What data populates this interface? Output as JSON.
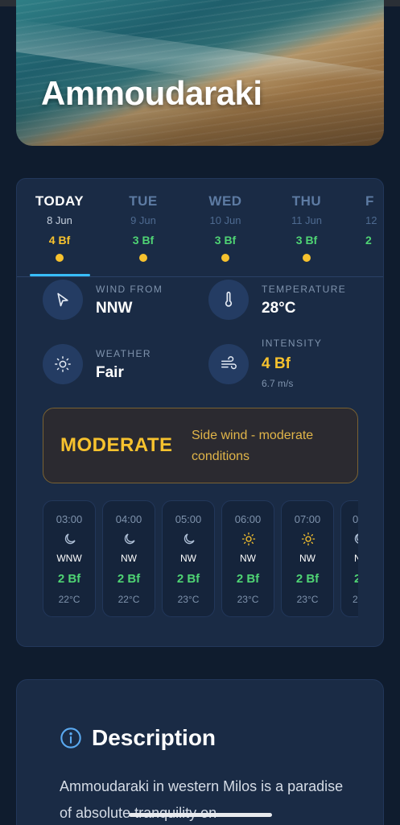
{
  "location": {
    "name": "Ammoudaraki"
  },
  "days": [
    {
      "name": "TODAY",
      "date": "8 Jun",
      "bf": "4 Bf",
      "active": true
    },
    {
      "name": "TUE",
      "date": "9 Jun",
      "bf": "3 Bf"
    },
    {
      "name": "WED",
      "date": "10 Jun",
      "bf": "3 Bf"
    },
    {
      "name": "THU",
      "date": "11 Jun",
      "bf": "3 Bf"
    },
    {
      "name": "F",
      "date": "12",
      "bf": "2"
    }
  ],
  "metrics": {
    "wind_from": {
      "label": "WIND FROM",
      "value": "NNW",
      "icon": "navigation-arrow-icon"
    },
    "temperature": {
      "label": "TEMPERATURE",
      "value": "28°C",
      "icon": "thermometer-icon"
    },
    "weather": {
      "label": "WEATHER",
      "value": "Fair",
      "icon": "sun-icon"
    },
    "intensity": {
      "label": "INTENSITY",
      "value": "4 Bf",
      "sub": "6.7 m/s",
      "icon": "wind-icon"
    }
  },
  "condition": {
    "level": "MODERATE",
    "description": "Side wind - moderate conditions"
  },
  "hourly": [
    {
      "time": "03:00",
      "icon": "moon-icon",
      "dir": "WNW",
      "bf": "2 Bf",
      "temp": "22°C"
    },
    {
      "time": "04:00",
      "icon": "moon-icon",
      "dir": "NW",
      "bf": "2 Bf",
      "temp": "22°C"
    },
    {
      "time": "05:00",
      "icon": "moon-icon",
      "dir": "NW",
      "bf": "2 Bf",
      "temp": "23°C"
    },
    {
      "time": "06:00",
      "icon": "sun-icon",
      "dir": "NW",
      "bf": "2 Bf",
      "temp": "23°C"
    },
    {
      "time": "07:00",
      "icon": "sun-icon",
      "dir": "NW",
      "bf": "2 Bf",
      "temp": "23°C"
    },
    {
      "time": "0",
      "icon": "moon-icon",
      "dir": "N",
      "bf": "2",
      "temp": "2"
    }
  ],
  "description": {
    "title": "Description",
    "text": "Ammoudaraki in western Milos is a paradise of absolute tranquility on"
  },
  "colors": {
    "background": "#0f1c2e",
    "card": "#1a2b45",
    "accent_blue": "#38bdf8",
    "bf_green": "#4fd474",
    "bf_yellow": "#f7c22e"
  }
}
